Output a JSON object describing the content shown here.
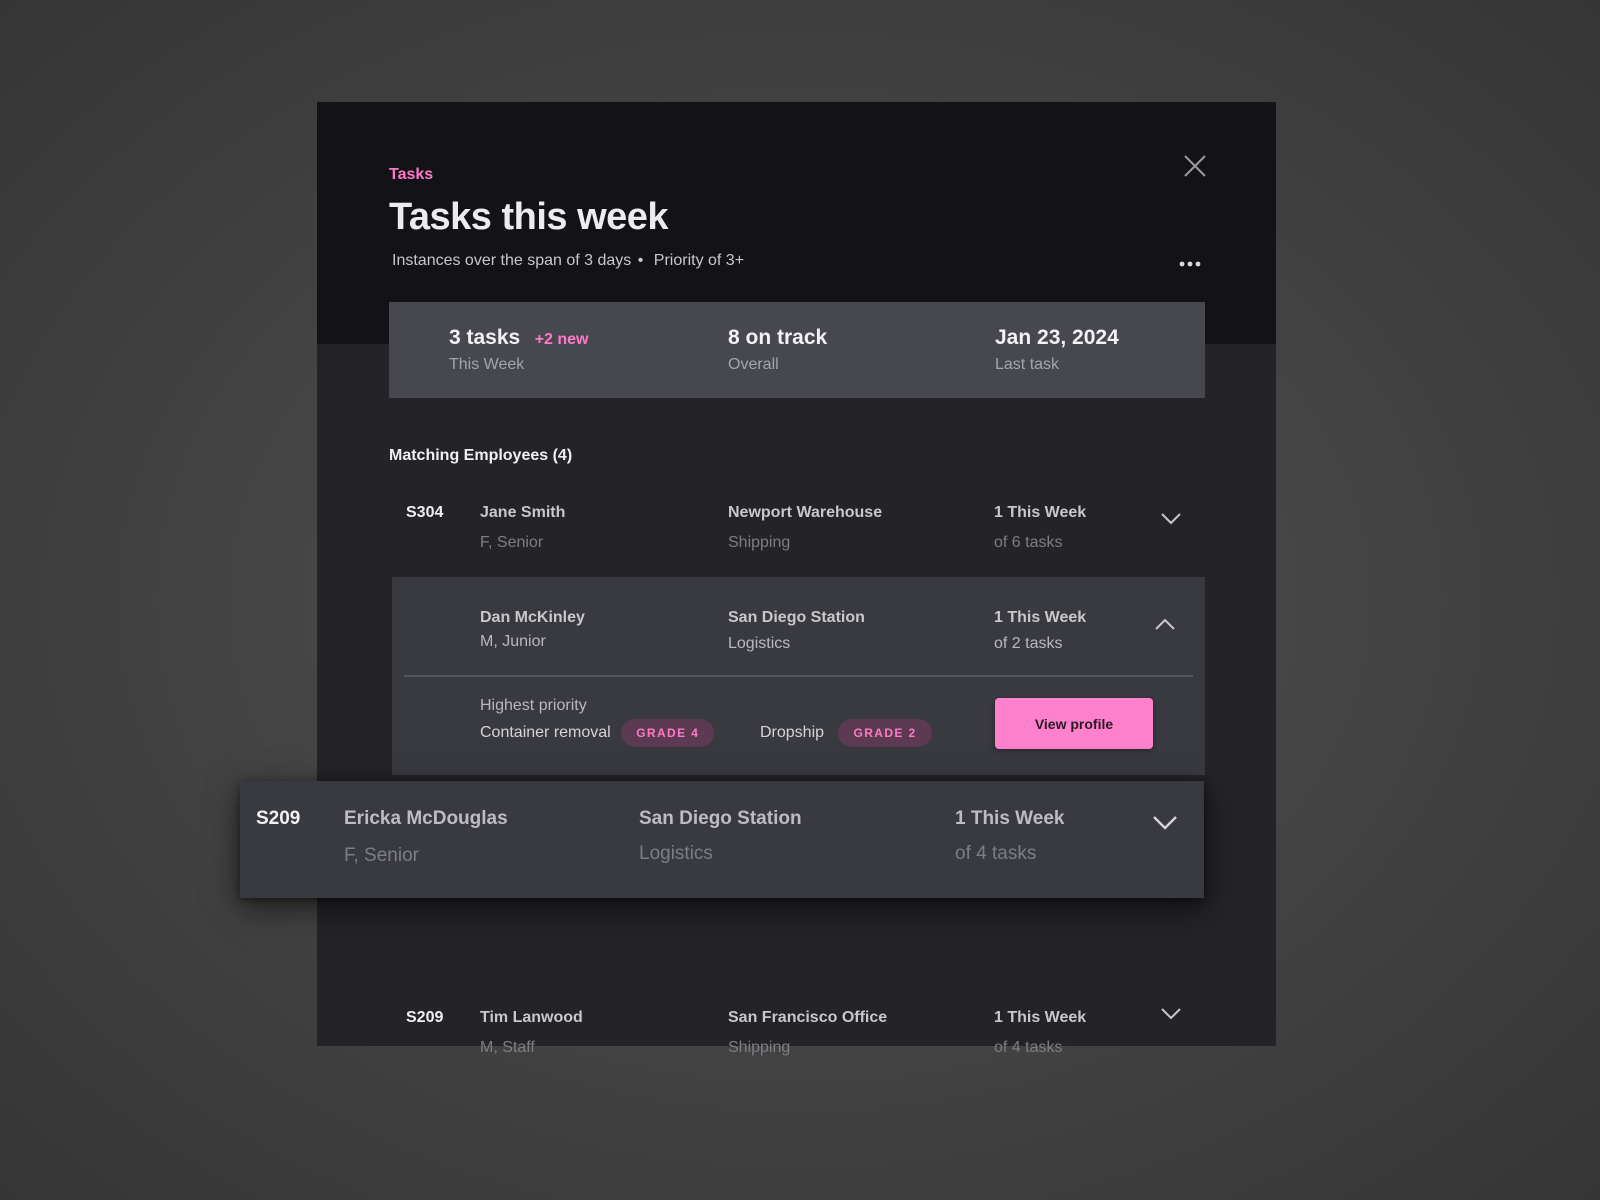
{
  "header": {
    "eyebrow": "Tasks",
    "title": "Tasks this week",
    "subtitle_span": "Instances over the span of 3 days",
    "subtitle_sep": "•",
    "subtitle_priority": "Priority of 3+"
  },
  "stats": [
    {
      "value": "3 tasks",
      "extra": "+2 new",
      "label": "This Week"
    },
    {
      "value": "8 on track",
      "label": "Overall"
    },
    {
      "value": "Jan 23, 2024",
      "label": "Last task"
    }
  ],
  "section_title": "Matching Employees (4)",
  "employees": [
    {
      "id": "S304",
      "name": "Jane Smith",
      "meta": "F, Senior",
      "location": "Newport Warehouse",
      "dept": "Shipping",
      "week": "1 This Week",
      "tasks": "of 6 tasks"
    },
    {
      "id": "",
      "name": "Dan McKinley",
      "meta": "M, Junior",
      "location": "San Diego Station",
      "dept": "Logistics",
      "week": "1 This Week",
      "tasks": "of 2 tasks"
    },
    {
      "id": "S209",
      "name": "Ericka McDouglas",
      "meta": "F, Senior",
      "location": "San Diego Station",
      "dept": "Logistics",
      "week": "1 This Week",
      "tasks": "of 4 tasks"
    },
    {
      "id": "S209",
      "name": "Tim Lanwood",
      "meta": "M, Staff",
      "location": "San Francisco Office",
      "dept": "Shipping",
      "week": "1 This Week",
      "tasks": "of 4 tasks"
    }
  ],
  "details": {
    "heading": "Highest priority",
    "task1": "Container removal",
    "task1_grade": "GRADE 4",
    "task2": "Dropship",
    "task2_grade": "GRADE 2",
    "button": "View profile"
  },
  "icons": {
    "close": "close-icon",
    "more": "more-horizontal-icon",
    "expand": "chevron-down-icon",
    "collapse": "chevron-up-icon"
  },
  "colors": {
    "accent": "#ff7ac6",
    "modal_top": "#121217",
    "modal_body": "#232328",
    "stats_bar": "#474750",
    "expanded_row": "#393940",
    "badge_bg": "#5b3a52"
  }
}
